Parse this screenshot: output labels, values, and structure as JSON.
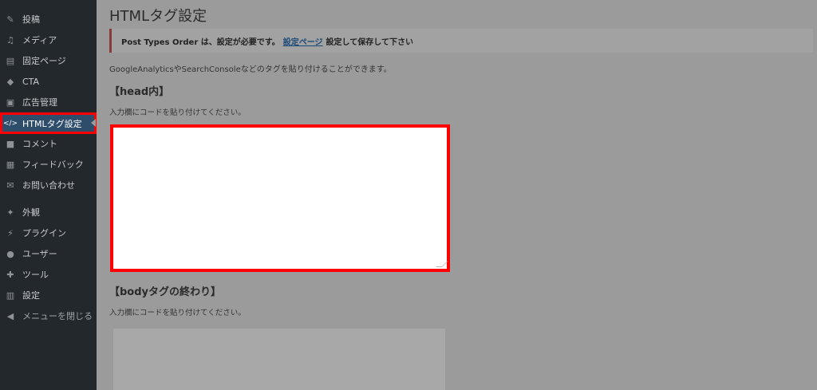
{
  "sidebar": {
    "items": [
      {
        "label": "投稿",
        "icon": "pin-icon",
        "glyph": "✎"
      },
      {
        "label": "メディア",
        "icon": "media-icon",
        "glyph": "♫"
      },
      {
        "label": "固定ページ",
        "icon": "page-icon",
        "glyph": "▤"
      },
      {
        "label": "CTA",
        "icon": "tag-icon",
        "glyph": "◆"
      },
      {
        "label": "広告管理",
        "icon": "ad-icon",
        "glyph": "▣"
      },
      {
        "label": "HTMLタグ設定",
        "icon": "code-icon",
        "glyph": "</>"
      },
      {
        "label": "コメント",
        "icon": "comment-icon",
        "glyph": "■"
      },
      {
        "label": "フィードバック",
        "icon": "feedback-icon",
        "glyph": "▦"
      },
      {
        "label": "お問い合わせ",
        "icon": "mail-icon",
        "glyph": "✉"
      },
      {
        "label": "外観",
        "icon": "brush-icon",
        "glyph": "✦"
      },
      {
        "label": "プラグイン",
        "icon": "plugin-icon",
        "glyph": "⚡"
      },
      {
        "label": "ユーザー",
        "icon": "user-icon",
        "glyph": "●"
      },
      {
        "label": "ツール",
        "icon": "wrench-icon",
        "glyph": "✚"
      },
      {
        "label": "設定",
        "icon": "settings-icon",
        "glyph": "▥"
      },
      {
        "label": "メニューを閉じる",
        "icon": "collapse-icon",
        "glyph": "◀"
      }
    ]
  },
  "page": {
    "title": "HTMLタグ設定",
    "notice": {
      "prefix": "Post Types Order は、設定が必要です。",
      "link": "設定ページ",
      "suffix": "設定して保存して下さい"
    },
    "description": "GoogleAnalyticsやSearchConsoleなどのタグを貼り付けることができます。",
    "head_section": {
      "heading": "【head内】",
      "hint": "入力欄にコードを貼り付けてください。",
      "value": ""
    },
    "body_section": {
      "heading": "【bodyタグの終わり】",
      "hint": "入力欄にコードを貼り付けてください。",
      "value": ""
    }
  },
  "colors": {
    "sidebar_bg": "#23282d",
    "active_bg": "#2e4d6b",
    "highlight": "#ff0000",
    "overlay": "#9b9b9b"
  }
}
